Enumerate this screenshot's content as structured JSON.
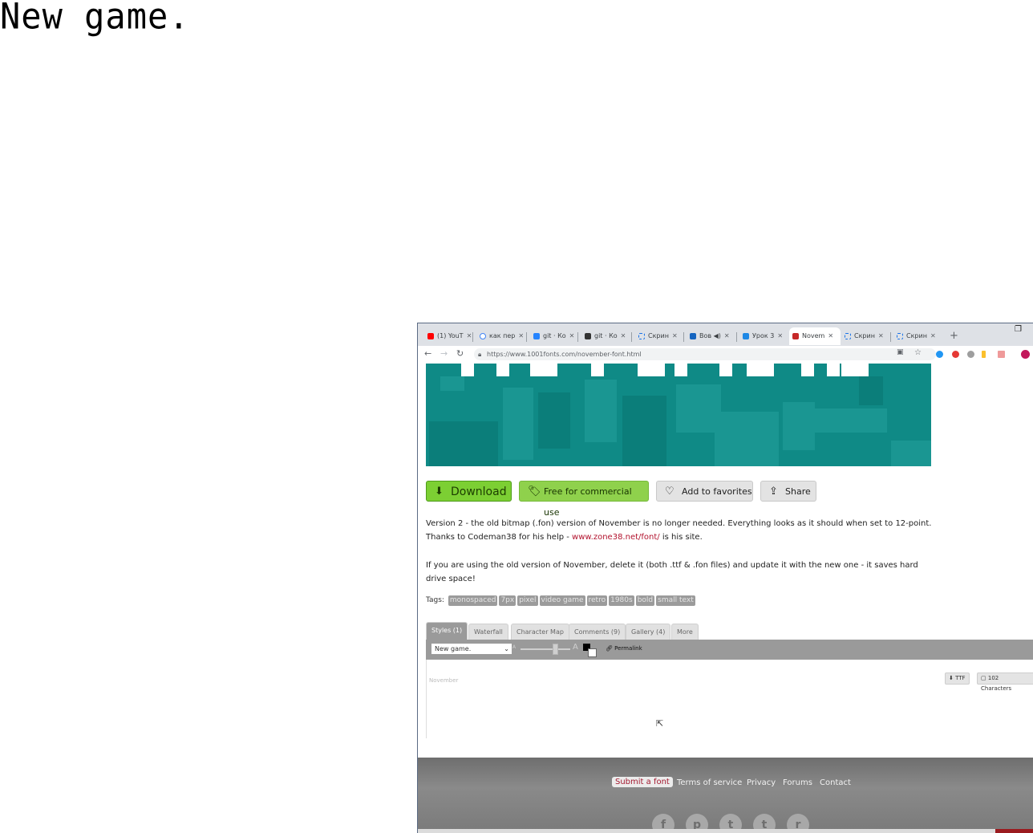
{
  "overlay": {
    "title": "New game."
  },
  "browser": {
    "tabs": [
      {
        "label": "(1) YouT",
        "icon": "youtube-icon",
        "color": "#ff0000"
      },
      {
        "label": "как пер",
        "icon": "google-icon",
        "color": "#4285f4"
      },
      {
        "label": "git · Ко",
        "icon": "jira-icon",
        "color": "#2684ff"
      },
      {
        "label": "git · Ко",
        "icon": "glasses-icon",
        "color": "#333333"
      },
      {
        "label": "Скрин",
        "icon": "screenshot-icon",
        "color": "#1a73e8"
      },
      {
        "label": "Вов ◀)",
        "icon": "video-icon",
        "color": "#1565c0"
      },
      {
        "label": "Урок 3",
        "icon": "monitor-icon",
        "color": "#1e88e5"
      },
      {
        "label": "Novem",
        "icon": "1001fonts-icon",
        "color": "#c62828"
      },
      {
        "label": "Скрин",
        "icon": "screenshot-icon",
        "color": "#1a73e8"
      },
      {
        "label": "Скрин",
        "icon": "screenshot-icon",
        "color": "#1a73e8"
      }
    ],
    "new_tab": "+",
    "url": "https://www.1001fonts.com/november-font.html"
  },
  "page": {
    "buttons": {
      "download": "Download",
      "free": "Free for commercial use",
      "favorites": "Add to favorites",
      "share": "Share"
    },
    "description": {
      "line1": "Version 2 - the old bitmap (.fon) version of November is no longer needed. Everything looks as it should when set to 12-point.",
      "line2_before": "Thanks to Codeman38 for his help - ",
      "line2_link": "www.zone38.net/font/",
      "line2_after": " is his site.",
      "line3": "If you are using the old version of November, delete it (both .ttf & .fon files) and update it with the new one - it saves hard drive space!"
    },
    "tags_label": "Tags:",
    "tags": [
      "monospaced",
      "7px",
      "pixel",
      "video game",
      "retro",
      "1980s",
      "bold",
      "small text"
    ],
    "font_tabs": [
      "Styles (1)",
      "Waterfall",
      "Character Map",
      "Comments (9)",
      "Gallery (4)",
      "More"
    ],
    "sample_text": "New game.",
    "slider_small": "A",
    "slider_large": "A",
    "permalink": "Permalink",
    "preview": {
      "font_name": "November",
      "ttf_button": "TTF",
      "chars_button": "102 Characters"
    },
    "footer_links": [
      "Submit a font",
      "Terms of service",
      "Privacy",
      "Forums",
      "Contact"
    ],
    "social": [
      "f",
      "p",
      "t",
      "t",
      "r"
    ]
  }
}
